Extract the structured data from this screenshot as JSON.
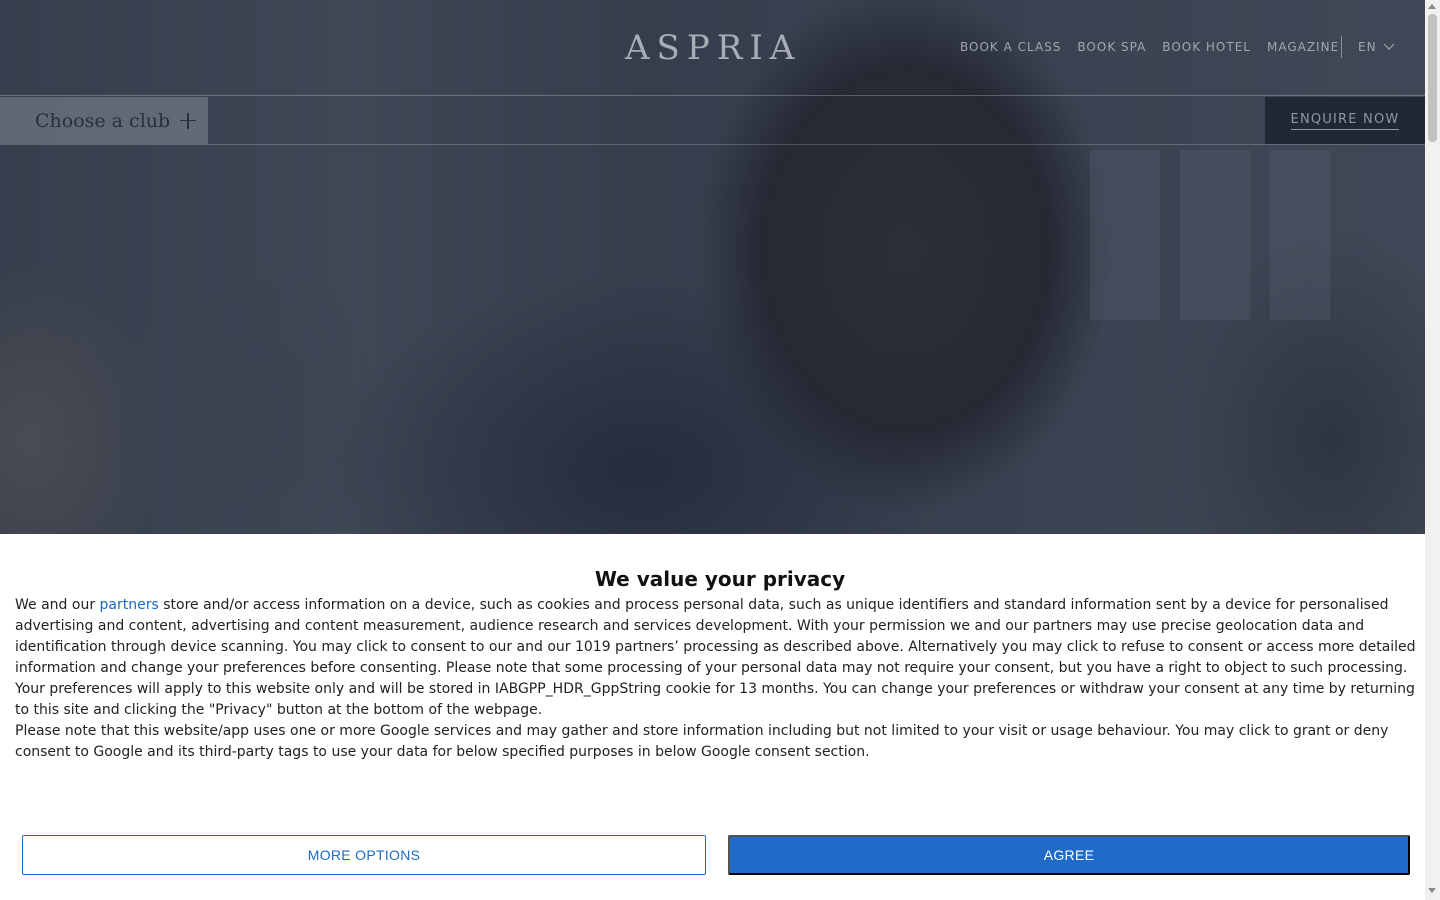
{
  "header": {
    "logo": "ASPRIA",
    "nav": [
      "BOOK A CLASS",
      "BOOK SPA",
      "BOOK HOTEL",
      "MAGAZINE"
    ],
    "language": "EN"
  },
  "subbar": {
    "choose_club": "Choose a club",
    "enquire": "ENQUIRE NOW"
  },
  "consent": {
    "title": "We value your privacy",
    "p1_before": "We and our ",
    "p1_link": "partners",
    "p1_after": " store and/or access information on a device, such as cookies and process personal data, such as unique identifiers and standard information sent by a device for personalised advertising and content, advertising and content measurement, audience research and services development. With your permission we and our partners may use precise geolocation data and identification through device scanning. You may click to consent to our and our 1019 partners’ processing as described above. Alternatively you may click to refuse to consent or access more detailed information and change your preferences before consenting. Please note that some processing of your personal data may not require your consent, but you have a right to object to such processing. Your preferences will apply to this website only and will be stored in IABGPP_HDR_GppString cookie for 13 months. You can change your preferences or withdraw your consent at any time by returning to this site and clicking the \"Privacy\" button at the bottom of the webpage.",
    "p2": "Please note that this website/app uses one or more Google services and may gather and store information including but not limited to your visit or usage behaviour. You may click to grant or deny consent to Google and its third-party tags to use your data for below specified purposes in below Google consent section.",
    "more_options": "MORE OPTIONS",
    "agree": "AGREE"
  }
}
